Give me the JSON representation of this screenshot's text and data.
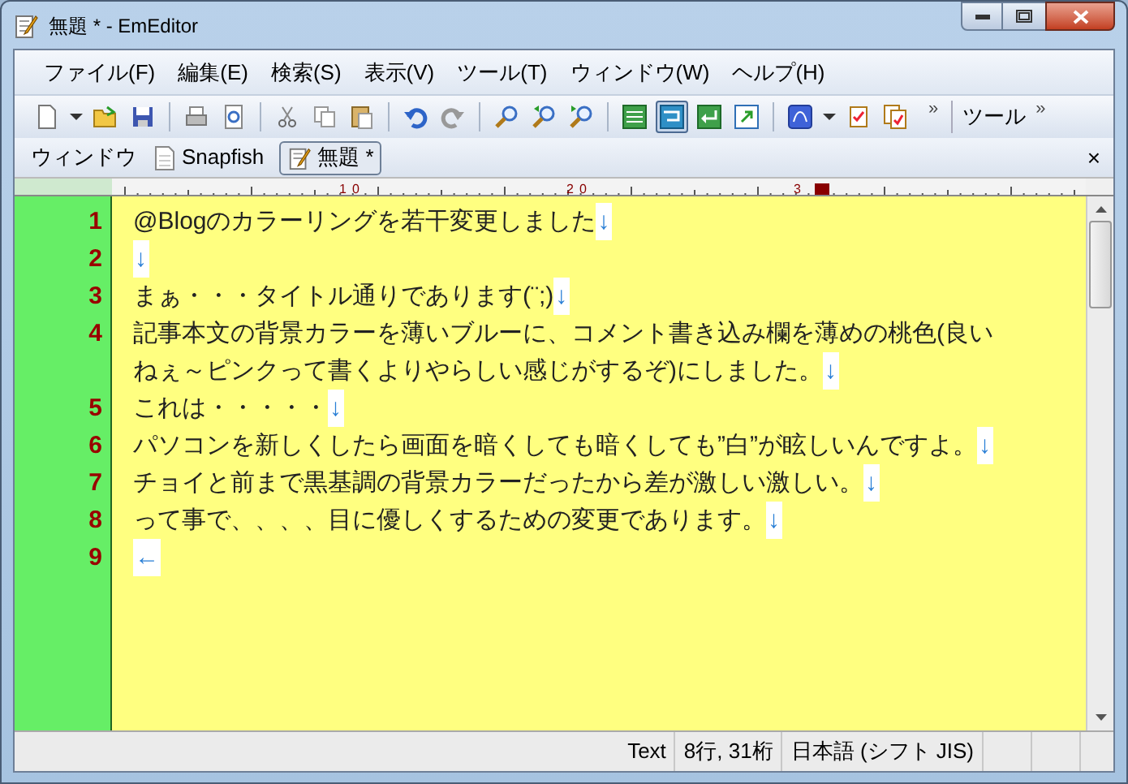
{
  "window": {
    "title": "無題 * - EmEditor"
  },
  "menu": [
    "ファイル(F)",
    "編集(E)",
    "検索(S)",
    "表示(V)",
    "ツール(T)",
    "ウィンドウ(W)",
    "ヘルプ(H)"
  ],
  "toolbar": {
    "overflow": "»",
    "tools_label": "ツール",
    "tools_overflow": "»"
  },
  "tabs_bar": {
    "label": "ウィンドウ",
    "close": "×",
    "tabs": [
      {
        "label": "Snapfish",
        "selected": false
      },
      {
        "label": "無題 *",
        "selected": true
      }
    ]
  },
  "ruler": {
    "marks": [
      "1",
      "0",
      "2",
      "0",
      "3"
    ]
  },
  "editor": {
    "lines": [
      {
        "number": "1",
        "rows": [
          "@Blogのカラーリングを若干変更しました"
        ],
        "end": "↓"
      },
      {
        "number": "2",
        "end": "↓"
      },
      {
        "number": "3",
        "rows": [
          "まぁ・・・タイトル通りであります(¨;)"
        ],
        "end": "↓"
      },
      {
        "number": "4",
        "rows": [
          "記事本文の背景カラーを薄いブルーに、コメント書き込み欄を薄めの桃色(良い",
          "ねぇ～ピンクって書くよりやらしい感じがするぞ)にしました。"
        ],
        "end": "↓"
      },
      {
        "number": "5",
        "rows": [
          "これは・・・・・"
        ],
        "end": "↓"
      },
      {
        "number": "6",
        "rows": [
          "パソコンを新しくしたら画面を暗くしても暗くしても”白”が眩しいんですよ。"
        ],
        "end": "↓"
      },
      {
        "number": "7",
        "rows": [
          "チョイと前まで黒基調の背景カラーだったから差が激しい激しい。"
        ],
        "end": "↓"
      },
      {
        "number": "8",
        "rows": [
          "って事で、、、、目に優しくするための変更であります。"
        ],
        "end": "↓"
      },
      {
        "number": "9",
        "end": "←"
      }
    ]
  },
  "status_bar": [
    "Text",
    "8行, 31桁",
    "日本語 (シフト JIS)"
  ]
}
